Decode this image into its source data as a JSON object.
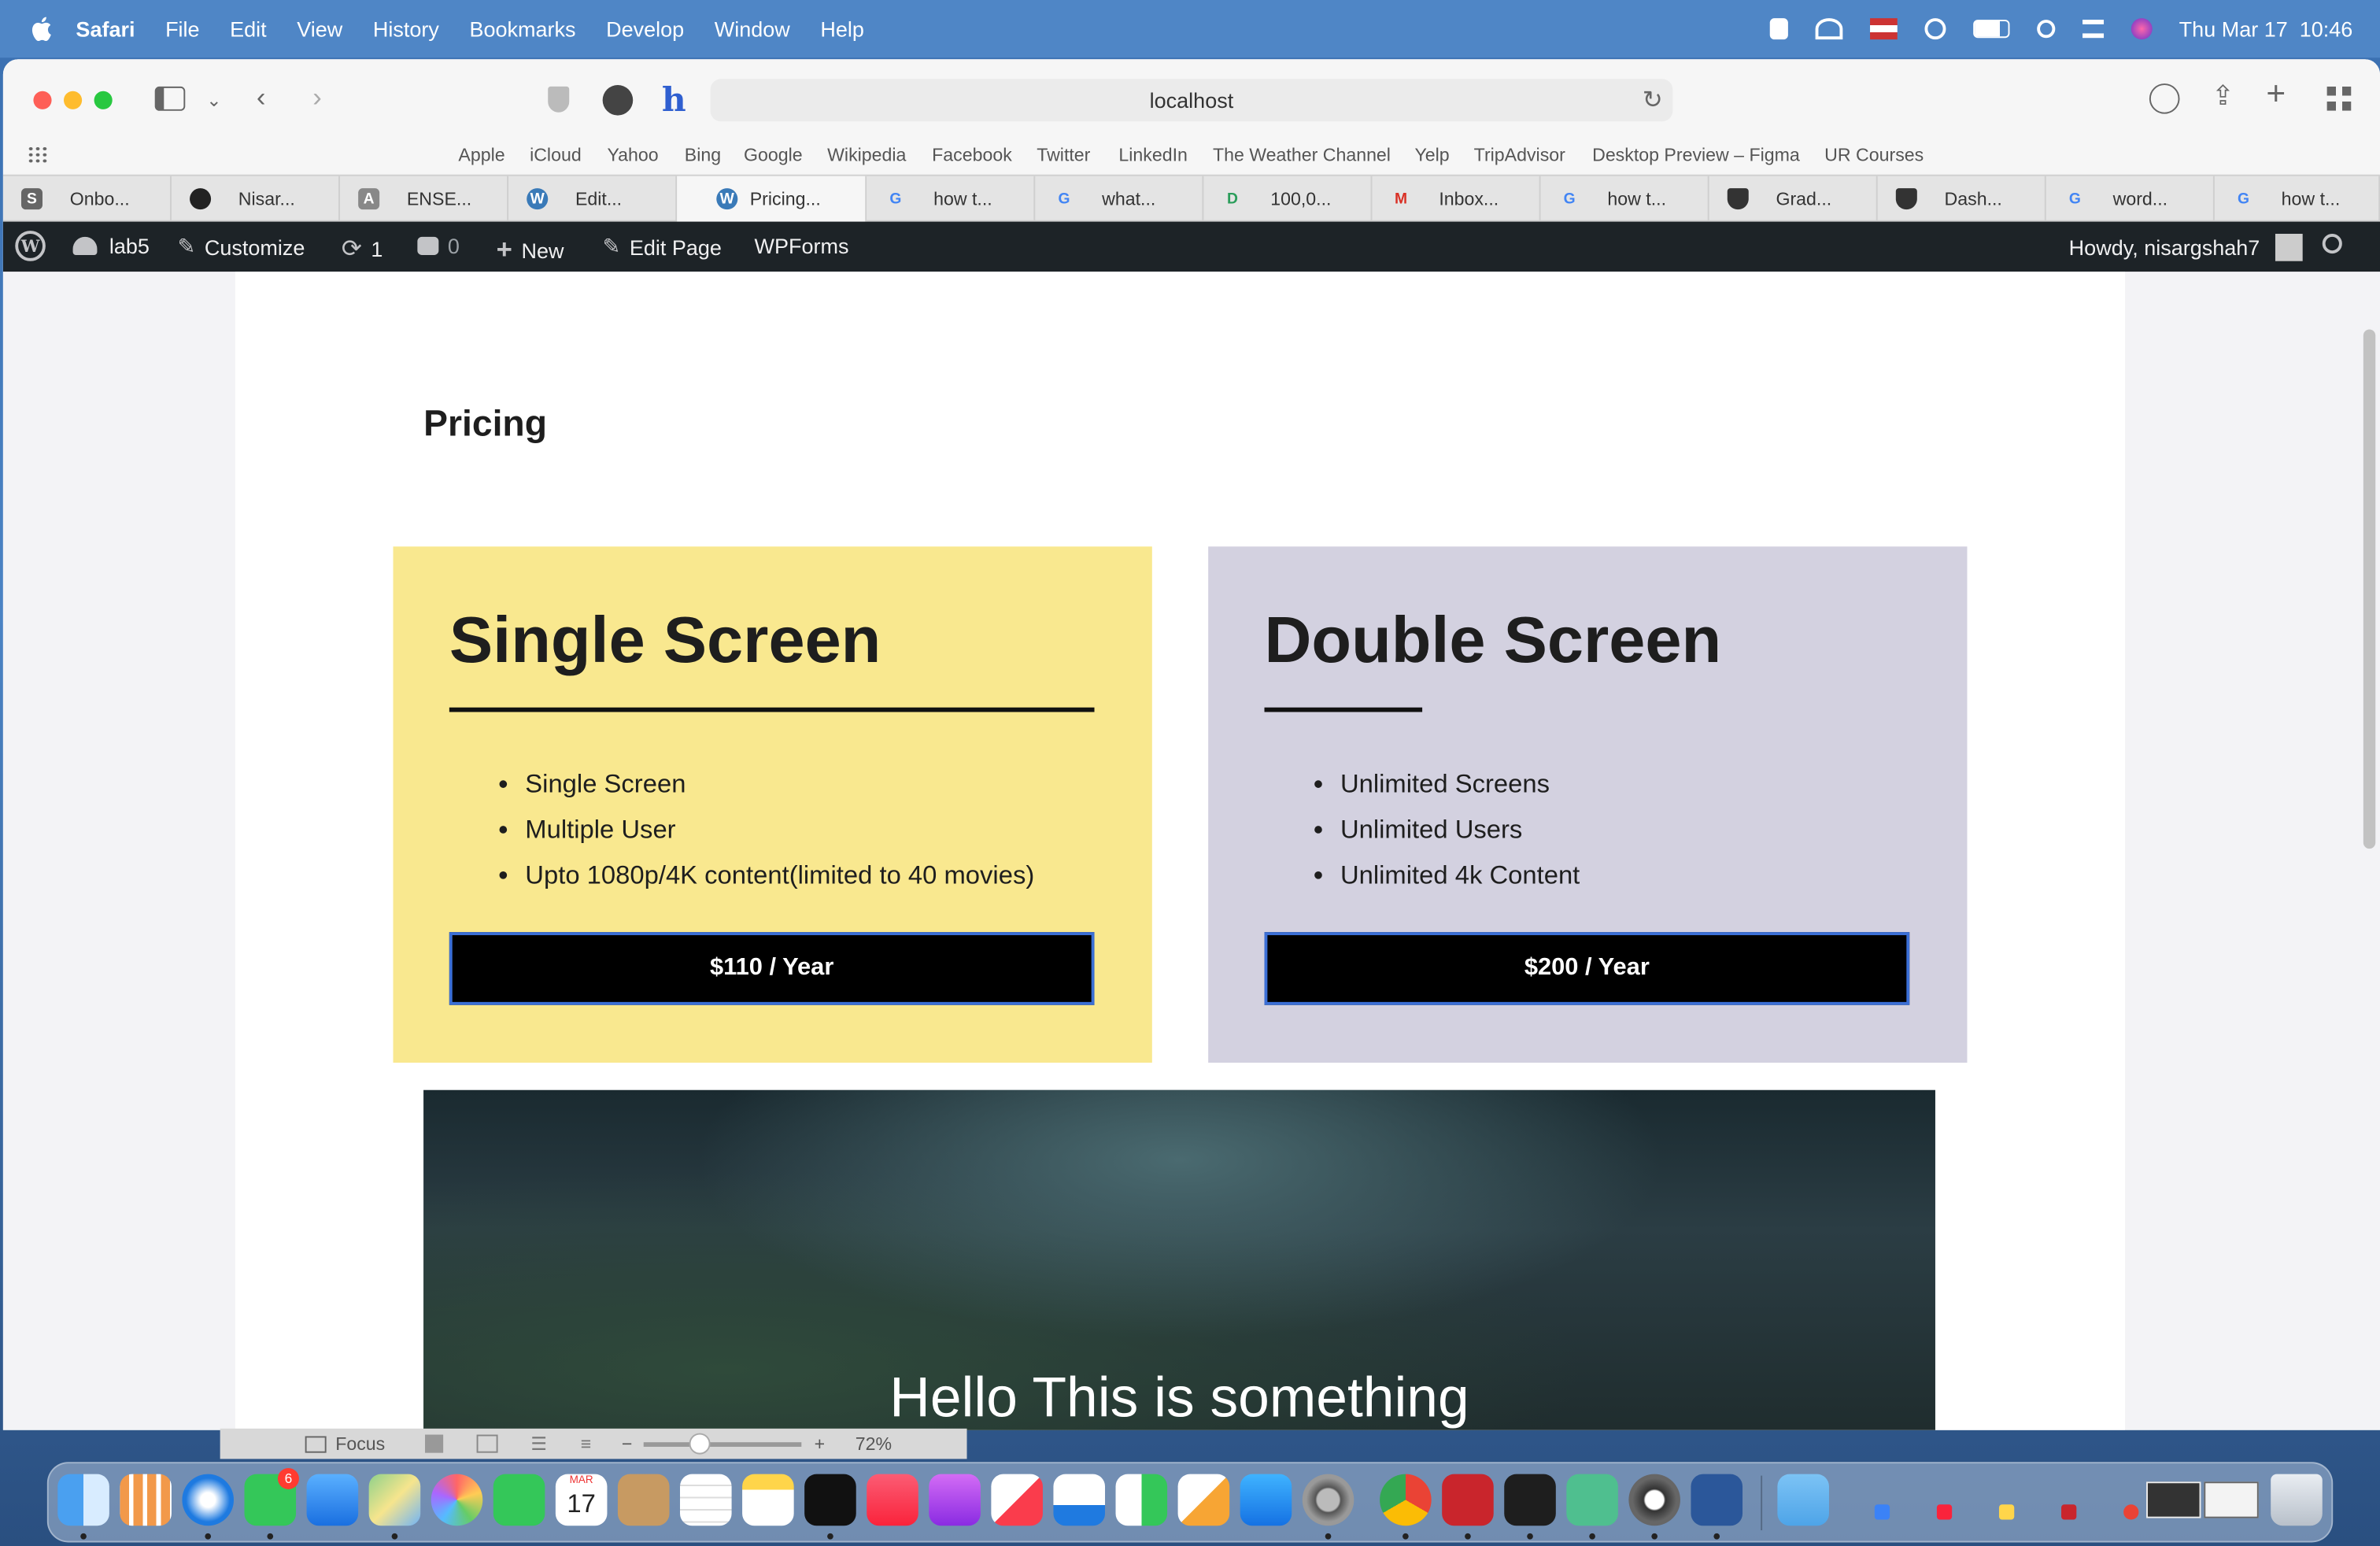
{
  "menubar": {
    "app_name": "Safari",
    "items": [
      "File",
      "Edit",
      "View",
      "History",
      "Bookmarks",
      "Develop",
      "Window",
      "Help"
    ],
    "datetime": "Thu Mar 17  10:46"
  },
  "browser": {
    "address": "localhost",
    "favorites": [
      "Apple",
      "iCloud",
      "Yahoo",
      "Bing",
      "Google",
      "Wikipedia",
      "Facebook",
      "Twitter",
      "LinkedIn",
      "The Weather Channel",
      "Yelp",
      "TripAdvisor",
      "Desktop Preview – Figma",
      "UR Courses"
    ],
    "tabs": [
      "Onbo...",
      "Nisar...",
      "ENSE...",
      "Edit...",
      "Pricing...",
      "how t...",
      "what...",
      "100,0...",
      "Inbox...",
      "how t...",
      "Grad...",
      "Dash...",
      "word...",
      "how t..."
    ],
    "active_tab": 4,
    "zoom": "72%",
    "status_focus": "Focus"
  },
  "wp_admin_bar": {
    "site": "lab5",
    "customize": "Customize",
    "updates": "1",
    "comments": "0",
    "new": "New",
    "edit_page": "Edit Page",
    "wpforms": "WPForms",
    "howdy": "Howdy, nisargshah7"
  },
  "page": {
    "title": "Pricing",
    "plans": [
      {
        "name": "Single Screen",
        "features": [
          "Single Screen",
          "Multiple User",
          "Upto 1080p/4K content(limited to 40 movies)"
        ],
        "price": "$110 / Year",
        "bg": "#f9e88f"
      },
      {
        "name": "Double Screen",
        "features": [
          "Unlimited Screens",
          "Unlimited Users",
          "Unlimited 4k Content"
        ],
        "price": "$200 / Year",
        "bg": "#d3d1e0"
      }
    ],
    "hero_text": "Hello This is something"
  },
  "dock": {
    "messages_badge": "6",
    "calendar_month": "MAR",
    "calendar_day": "17"
  }
}
